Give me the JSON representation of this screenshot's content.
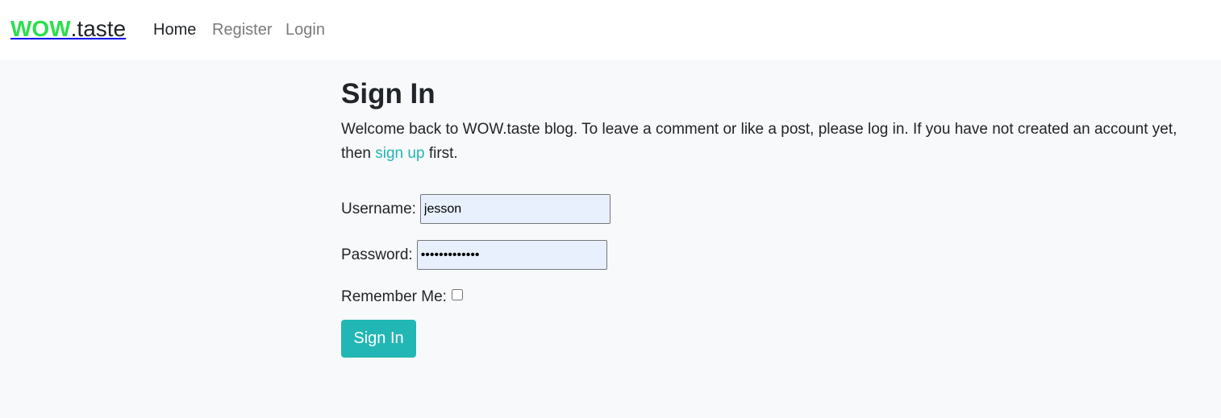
{
  "nav": {
    "brand_strong": "WOW",
    "brand_light": ".taste",
    "links": [
      {
        "label": "Home",
        "active": true
      },
      {
        "label": "Register",
        "active": false
      },
      {
        "label": "Login",
        "active": false
      }
    ]
  },
  "main": {
    "title": "Sign In",
    "intro_before": "Welcome back to WOW.taste blog. To leave a comment or like a post, please log in. If you have not created an account yet, then ",
    "intro_link": "sign up",
    "intro_after": " first.",
    "form": {
      "username_label": "Username:",
      "username_value": "jesson",
      "password_label": "Password:",
      "password_value": "•••••••••••••",
      "remember_label": "Remember Me:",
      "remember_checked": false,
      "submit_label": "Sign In"
    }
  },
  "colors": {
    "brand_green": "#2cde4e",
    "accent_teal": "#22b7b4",
    "page_bg": "#f8f9fa"
  }
}
